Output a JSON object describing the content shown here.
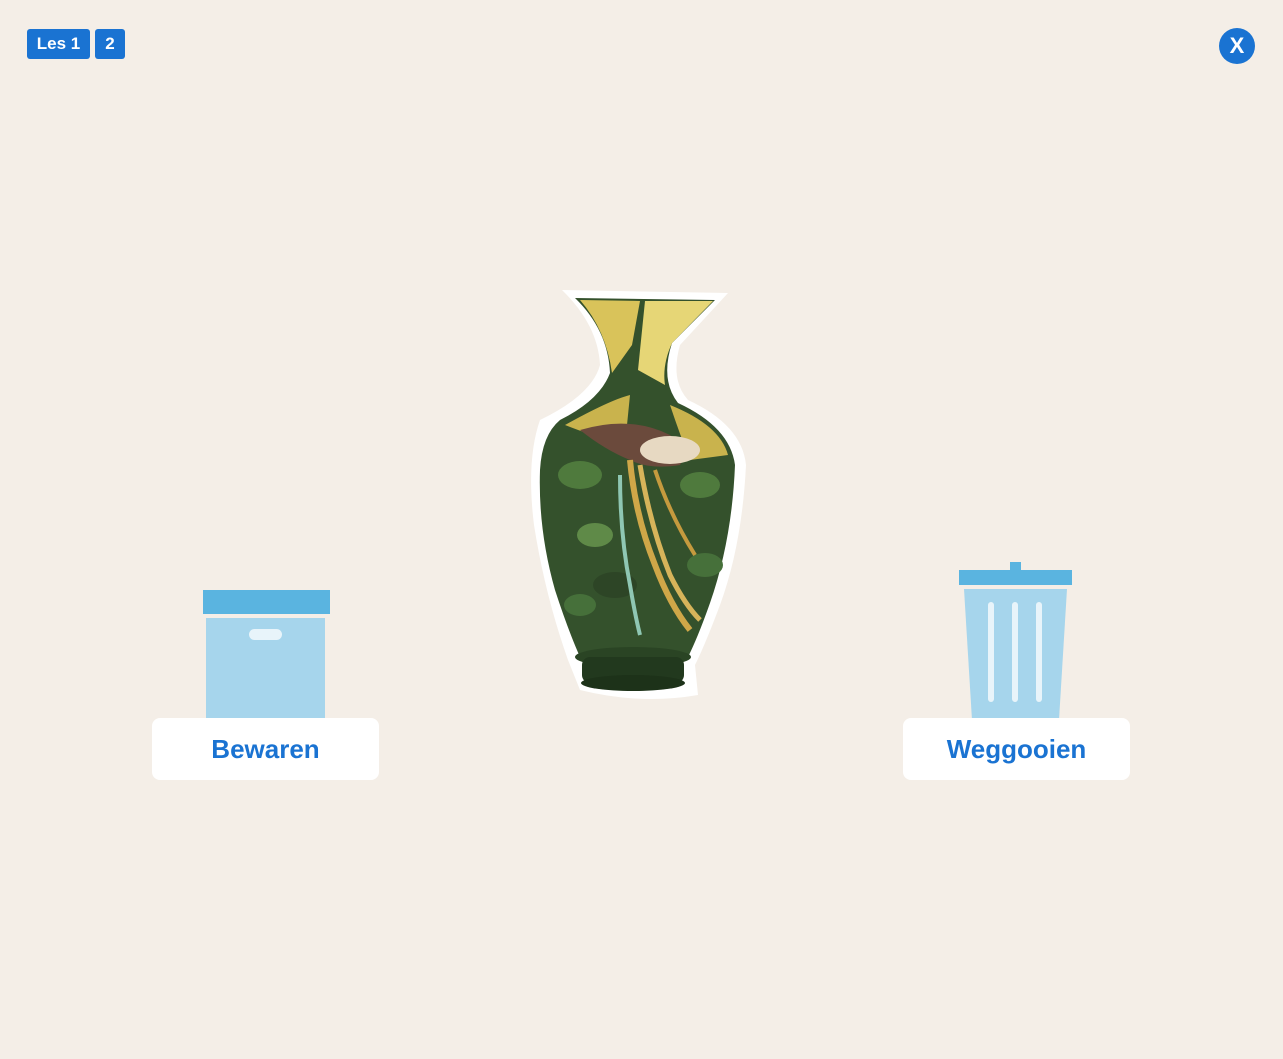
{
  "header": {
    "lesson_label": "Les 1",
    "lesson_step": "2",
    "close_label": "X"
  },
  "item": {
    "icon": "vase-image"
  },
  "targets": {
    "keep": {
      "label": "Bewaren",
      "icon": "storage-box-icon"
    },
    "discard": {
      "label": "Weggooien",
      "icon": "trash-can-icon"
    }
  },
  "colors": {
    "background": "#f4eee7",
    "accent": "#1a73d2",
    "icon_dark": "#5ab4e0",
    "icon_light": "#a6d5ec"
  }
}
